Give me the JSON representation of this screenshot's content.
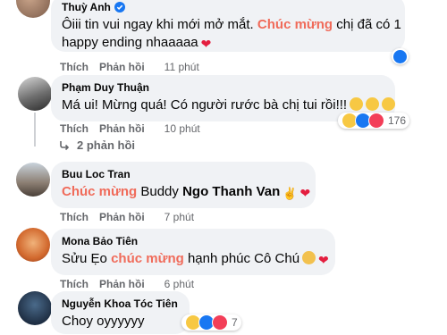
{
  "comments": [
    {
      "author": "Thuỳ Anh",
      "text_before": "Ôiii tin vui ngay khi mới mở mắt. ",
      "highlight": "Chúc mừng",
      "text_mid": " chị đã có 1",
      "text_line2": "happy ending nhaaaaa",
      "like_label": "Thích",
      "reply_label": "Phản hồi",
      "time": "11 phút"
    },
    {
      "author": "Phạm Duy Thuận",
      "text": "Má ui! Mừng quá! Có người rước bà chị tui rồi!!!",
      "like_label": "Thích",
      "reply_label": "Phản hồi",
      "time": "10 phút",
      "reaction_count": "176",
      "replies_label": "2 phản hồi"
    },
    {
      "author": "Buu Loc Tran",
      "highlight": "Chúc mừng",
      "text_mid": " Buddy ",
      "mention": "Ngo Thanh Van",
      "like_label": "Thích",
      "reply_label": "Phản hồi",
      "time": "7 phút"
    },
    {
      "author": "Mona Bảo Tiên",
      "text_before": "Sửu Ẹo ",
      "highlight": "chúc mừng",
      "text_after": " hạnh phúc Cô Chú",
      "like_label": "Thích",
      "reply_label": "Phản hồi",
      "time": "6 phút"
    },
    {
      "author": "Nguyễn Khoa Tóc Tiên",
      "text": "Choy oyyyyyy",
      "reaction_count": "7"
    }
  ],
  "colors": {
    "highlight": "#f06b5a",
    "bubble": "#f0f2f5",
    "meta": "#65676b",
    "verified": "#1877f2"
  }
}
